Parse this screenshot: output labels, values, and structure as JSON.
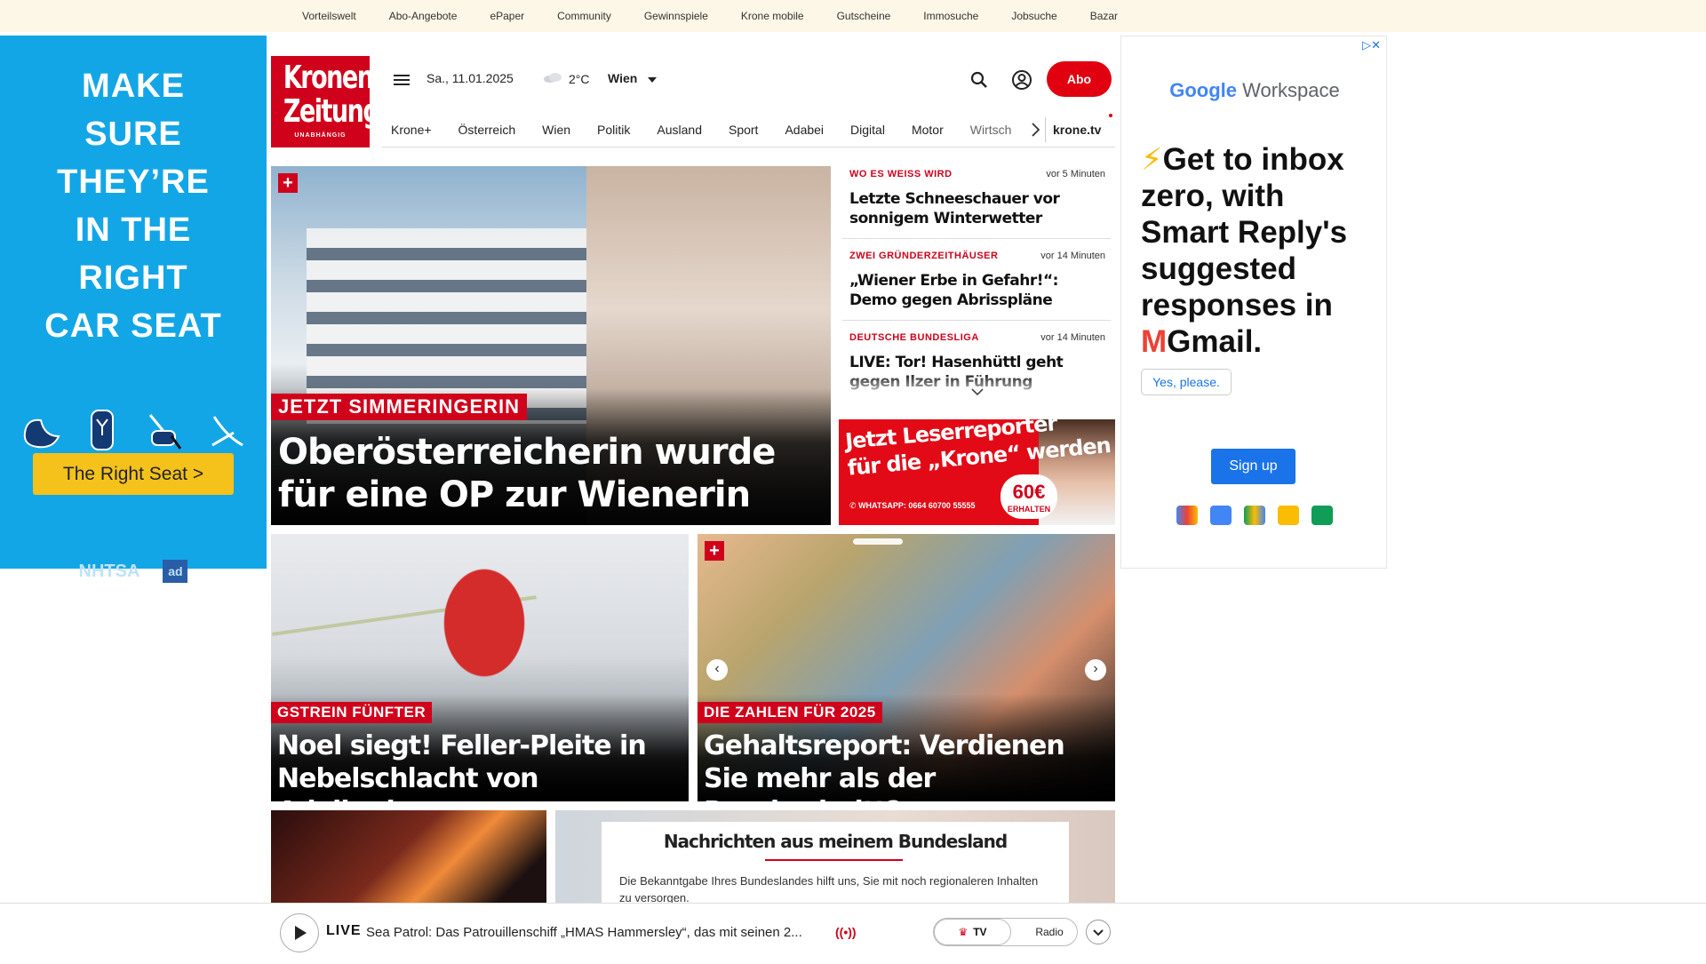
{
  "topbar": {
    "links": [
      "Vorteilswelt",
      "Abo-Angebote",
      "ePaper",
      "Community",
      "Gewinnspiele",
      "Krone mobile",
      "Gutscheine",
      "Immosuche",
      "Jobsuche",
      "Bazar"
    ]
  },
  "left_ad": {
    "headline_lines": [
      "MAKE",
      "SURE",
      "THEY’RE",
      "IN THE",
      "RIGHT",
      "CAR SEAT"
    ],
    "cta": "The Right Seat >",
    "logo_nhtsa": "NHTSA",
    "logo_ad": "ad",
    "background": "#13a6e6",
    "cta_color": "#f4c21a"
  },
  "header": {
    "logo_line1": "Kronen",
    "logo_line2": "Zeitung",
    "logo_tagline": "UNABHÄNGIG",
    "date": "Sa., 11.01.2025",
    "temperature": "2°C",
    "city": "Wien",
    "abo_label": "Abo",
    "accent": "#e1000f"
  },
  "nav": {
    "items": [
      "Krone+",
      "Österreich",
      "Wien",
      "Politik",
      "Ausland",
      "Sport",
      "Adabei",
      "Digital",
      "Motor",
      "Wirtsch"
    ],
    "tv_label": "krone.tv"
  },
  "hero": {
    "kicker": "JETZT SIMMERINGERIN",
    "title_line1": "Oberösterreicherin wurde",
    "title_line2": "für eine OP zur Wienerin",
    "plus": "+"
  },
  "news_list": [
    {
      "kicker": "WO ES WEISS WIRD",
      "time": "vor 5 Minuten",
      "title": "Letzte Schneeschauer vor sonnigem Winterwetter"
    },
    {
      "kicker": "ZWEI GRÜNDERZEITHÄUSER",
      "time": "vor 14 Minuten",
      "title": "„Wiener Erbe in Gefahr!“: Demo gegen Abrisspläne"
    },
    {
      "kicker": "DEUTSCHE BUNDESLIGA",
      "time": "vor 14 Minuten",
      "title": "LIVE: Tor! Hasenhüttl geht gegen Ilzer in Führung"
    }
  ],
  "reporter_ad": {
    "line1": "Jetzt Leserreporter",
    "line2": "für die „Krone“ werden",
    "whatsapp": "WHATSAPP: 0664 60700 55555",
    "amount": "60€",
    "amount_label": "ERHALTEN"
  },
  "right_ad": {
    "brand_google": "Google",
    "brand_product": "Workspace",
    "pitch": "Get to inbox zero, with Smart Reply's suggested responses in",
    "pitch_gmail": "Gmail.",
    "yes_label": "Yes, please.",
    "signup_label": "Sign up",
    "app_icons": [
      "gmail-icon",
      "calendar-icon",
      "drive-icon",
      "docs-icon",
      "meet-icon"
    ]
  },
  "cards": [
    {
      "kicker": "GSTREIN FÜNFTER",
      "title_line1": "Noel siegt! Feller-Pleite in",
      "title_line2": "Nebelschlacht von Adelboden"
    },
    {
      "kicker": "DIE ZAHLEN FÜR 2025",
      "title_line1": "Gehaltsreport: Verdienen",
      "title_line2": "Sie mehr als der Durchschnitt?",
      "plus": "+"
    }
  ],
  "region_popup": {
    "title": "Nachrichten aus meinem Bundesland",
    "text": "Die Bekanntgabe Ihres Bundeslandes hilft uns, Sie mit noch regionaleren Inhalten zu versorgen."
  },
  "player": {
    "live_label": "LIVE",
    "title": "Sea Patrol: Das Patrouillenschiff „HMAS Hammersley“, das mit seinen 2...",
    "tv_label": "TV",
    "radio_label": "Radio",
    "waves": "((•))"
  }
}
